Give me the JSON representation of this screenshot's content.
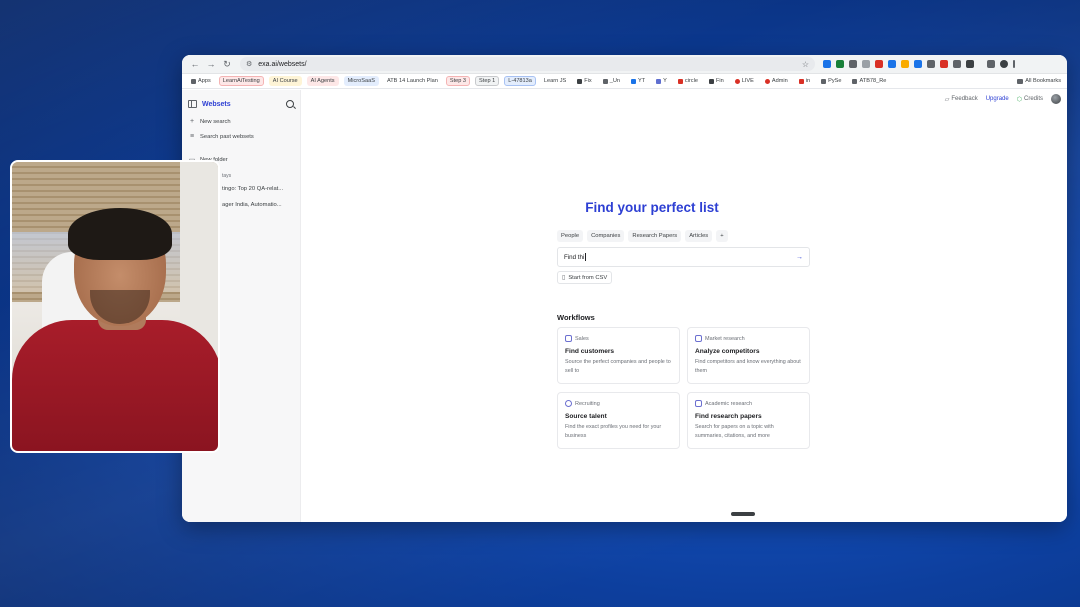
{
  "browser": {
    "url": "exa.ai/websets/",
    "bookmarks": [
      {
        "label": "Apps",
        "color": "#5f6368"
      },
      {
        "label": "LearnAiTesting",
        "color": "#d93025"
      },
      {
        "label": "AI Course",
        "color": "#f9ab00"
      },
      {
        "label": "AI Agents",
        "color": "#d93025"
      },
      {
        "label": "MicroSaaS",
        "color": "#1a73e8"
      },
      {
        "label": "ATB 14 Launch Plan",
        "color": "#5f6368"
      },
      {
        "label": "Step 3",
        "color": "#d93025"
      },
      {
        "label": "Step 1",
        "color": "#5f6368"
      },
      {
        "label": "L-47813a",
        "color": "#1a73e8"
      },
      {
        "label": "Learn JS",
        "color": "#5f6368"
      },
      {
        "label": "Fix",
        "color": "#3c4043"
      },
      {
        "label": "_Un",
        "color": "#3c4043"
      },
      {
        "label": "YT",
        "color": "#3c4043"
      },
      {
        "label": "Y",
        "color": "#3c4043"
      },
      {
        "label": "circle",
        "color": "#3c4043"
      },
      {
        "label": "Fin",
        "color": "#3c4043"
      },
      {
        "label": "LIVE",
        "color": "#d93025"
      },
      {
        "label": "Admin",
        "color": "#d93025"
      },
      {
        "label": "in",
        "color": "#d93025"
      },
      {
        "label": "PySe",
        "color": "#3c4043"
      },
      {
        "label": "ATB78_Re",
        "color": "#3c4043"
      }
    ],
    "all_bookmarks_label": "All Bookmarks"
  },
  "sidebar": {
    "title": "Websets",
    "items": [
      {
        "label": "New search",
        "icon": "plus-icon"
      },
      {
        "label": "Search past websets",
        "icon": "list-icon"
      },
      {
        "label": "New folder",
        "icon": "folder-icon"
      }
    ],
    "section_label": "tays",
    "history": [
      "tingo: Top 20 QA-relat...",
      "ager India, Automatio..."
    ]
  },
  "header": {
    "feedback": "Feedback",
    "upgrade": "Upgrade",
    "credits": "Credits"
  },
  "main": {
    "title": "Find your perfect list",
    "chips": [
      "People",
      "Companies",
      "Research Papers",
      "Articles",
      "+"
    ],
    "search_value": "Find thi",
    "csv_label": "Start from CSV",
    "workflows_title": "Workflows",
    "workflows": [
      {
        "tag": "Sales",
        "name": "Find customers",
        "desc": "Source the perfect companies and people to sell to"
      },
      {
        "tag": "Market research",
        "name": "Analyze competitors",
        "desc": "Find competitors and know everything about them"
      },
      {
        "tag": "Recruiting",
        "name": "Source talent",
        "desc": "Find the exact profiles you need for your business"
      },
      {
        "tag": "Academic research",
        "name": "Find research papers",
        "desc": "Search for papers on a topic with summaries, citations, and more"
      }
    ]
  },
  "colors": {
    "accent": "#2d3fd3",
    "background": "#0d3f9e"
  }
}
